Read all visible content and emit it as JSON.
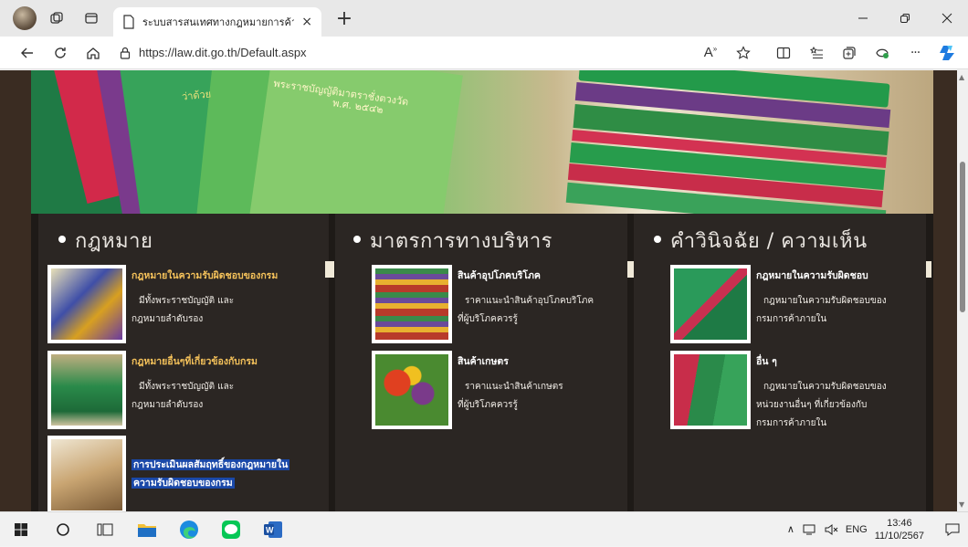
{
  "browser": {
    "tab_title": "ระบบสารสนเทศทางกฎหมายการค้าในป",
    "url": "https://law.dit.go.th/Default.aspx",
    "tab_close": "×",
    "new_tab": "+",
    "more": "···"
  },
  "banner": {
    "text_left": "ว่าด้วย",
    "text_line1": "พระราชบัญญัติมาตราชั่งตวงวัด",
    "text_line2": "พ.ศ. ๒๕๔๒"
  },
  "sections": [
    {
      "title": "กฎหมาย",
      "items": [
        {
          "title": "กฎหมายในความรับผิดชอบของกรม",
          "desc1": "มีทั้งพระราชบัญญัติ และ",
          "desc2": "กฎหมายลำดับรอง"
        },
        {
          "title": "กฎหมายอื่นๆที่เกี่ยวข้องกับกรม",
          "desc1": "มีทั้งพระราชบัญญัติ และ",
          "desc2": "กฎหมายลำดับรอง"
        },
        {
          "title_line1": "การประเมินผลสัมฤทธิ์ของกฎหมายใน",
          "title_line2": "ความรับผิดชอบของกรม"
        }
      ]
    },
    {
      "title": "มาตรการทางบริหาร",
      "items": [
        {
          "title": "สินค้าอุปโภคบริโภค",
          "desc1": "ราคาแนะนำสินค้าอุปโภคบริโภค",
          "desc2": "ที่ผู้บริโภคควรรู้"
        },
        {
          "title": "สินค้าเกษตร",
          "desc1": "ราคาแนะนำสินค้าเกษตร",
          "desc2": "ที่ผู้บริโภคควรรู้"
        }
      ]
    },
    {
      "title": "คำวินิจฉัย / ความเห็น",
      "items": [
        {
          "title": "กฎหมายในความรับผิดชอบ",
          "desc1": "กฎหมายในความรับผิดชอบของ",
          "desc2": "กรมการค้าภายใน"
        },
        {
          "title": "อื่น ๆ",
          "desc1": "กฎหมายในความรับผิดชอบของ",
          "desc2": "หน่วยงานอื่นๆ ที่เกี่ยวข้องกับ",
          "desc3": "กรมการค้าภายใน"
        }
      ]
    }
  ],
  "taskbar": {
    "language": "ENG",
    "time": "13:46",
    "date": "11/10/2567"
  },
  "colors": {
    "accent_yellow": "#f4c15a",
    "highlight_blue": "#1a48a8",
    "dark_bg": "#2b2623"
  }
}
